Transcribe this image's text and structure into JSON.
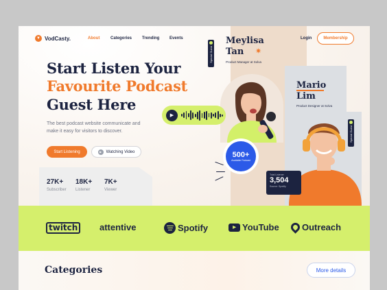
{
  "header": {
    "logo_text": "VodCasty.",
    "nav": [
      "About",
      "Categories",
      "Trending",
      "Events"
    ],
    "active_nav": "About",
    "login_label": "Login",
    "membership_label": "Membership"
  },
  "hero": {
    "title_line1": "Start Listen Your",
    "title_line2": "Favourite Podcast",
    "title_line3": "Guest Here",
    "description": "The best podcast website communicate and make it easy for visitors to discover.",
    "start_button": "Start Listening",
    "watch_button": "Watching Video",
    "stats": [
      {
        "value": "27K+",
        "label": "Subscriber"
      },
      {
        "value": "18K+",
        "label": "Listener"
      },
      {
        "value": "7K+",
        "label": "Viewer"
      }
    ]
  },
  "guests": [
    {
      "first": "Meylisa",
      "last": "Tan",
      "role": "Product Manager at Solva",
      "tag": "Special Guest"
    },
    {
      "first": "Mario",
      "last": "Lim",
      "role": "Product Designer at Solva",
      "tag": "Special Guest"
    }
  ],
  "badge": {
    "value": "500+",
    "label": "Available Podcast"
  },
  "listener_card": {
    "label": "Total Listener",
    "value": "3,504",
    "source": "Source: Spotify"
  },
  "brands": [
    "twitch",
    "attentive",
    "Spotify",
    "YouTube",
    "Outreach"
  ],
  "categories": {
    "title": "Categories",
    "more_label": "More details"
  },
  "colors": {
    "accent": "#f07a2c",
    "lime": "#d5ef6c",
    "navy": "#1c2340",
    "blue": "#2b5ae8"
  }
}
